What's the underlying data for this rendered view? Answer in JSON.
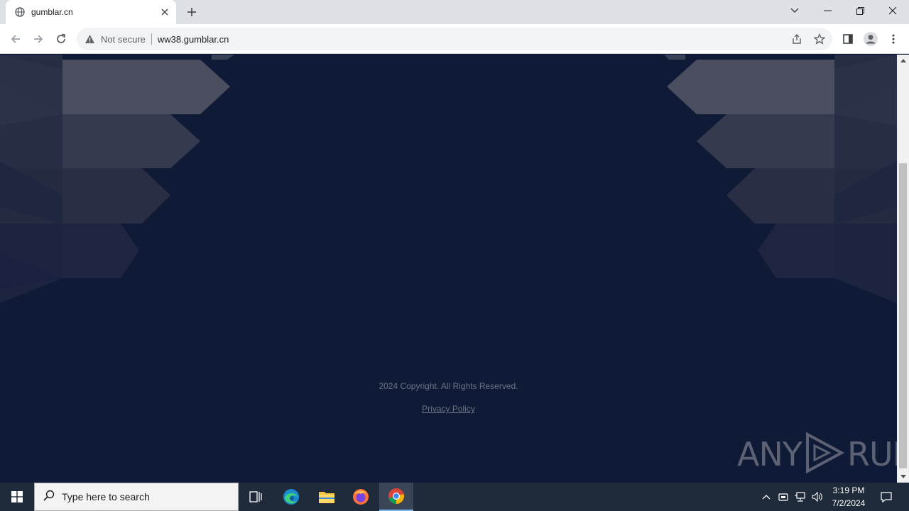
{
  "browser": {
    "tab": {
      "title": "gumblar.cn",
      "favicon": "globe-icon"
    },
    "address": {
      "security_label": "Not secure",
      "url": "ww38.gumblar.cn"
    }
  },
  "page": {
    "copyright": "2024 Copyright. All Rights Reserved.",
    "privacy_link": "Privacy Policy",
    "watermark": "ANY RUN",
    "watermark_left": "ANY",
    "watermark_right": "RUN"
  },
  "taskbar": {
    "search_placeholder": "Type here to search",
    "time": "3:19 PM",
    "date": "7/2/2024"
  },
  "colors": {
    "page_background": "#0f1b36",
    "taskbar": "#1f2a3a",
    "chrome_accent": "#76b9ed"
  }
}
